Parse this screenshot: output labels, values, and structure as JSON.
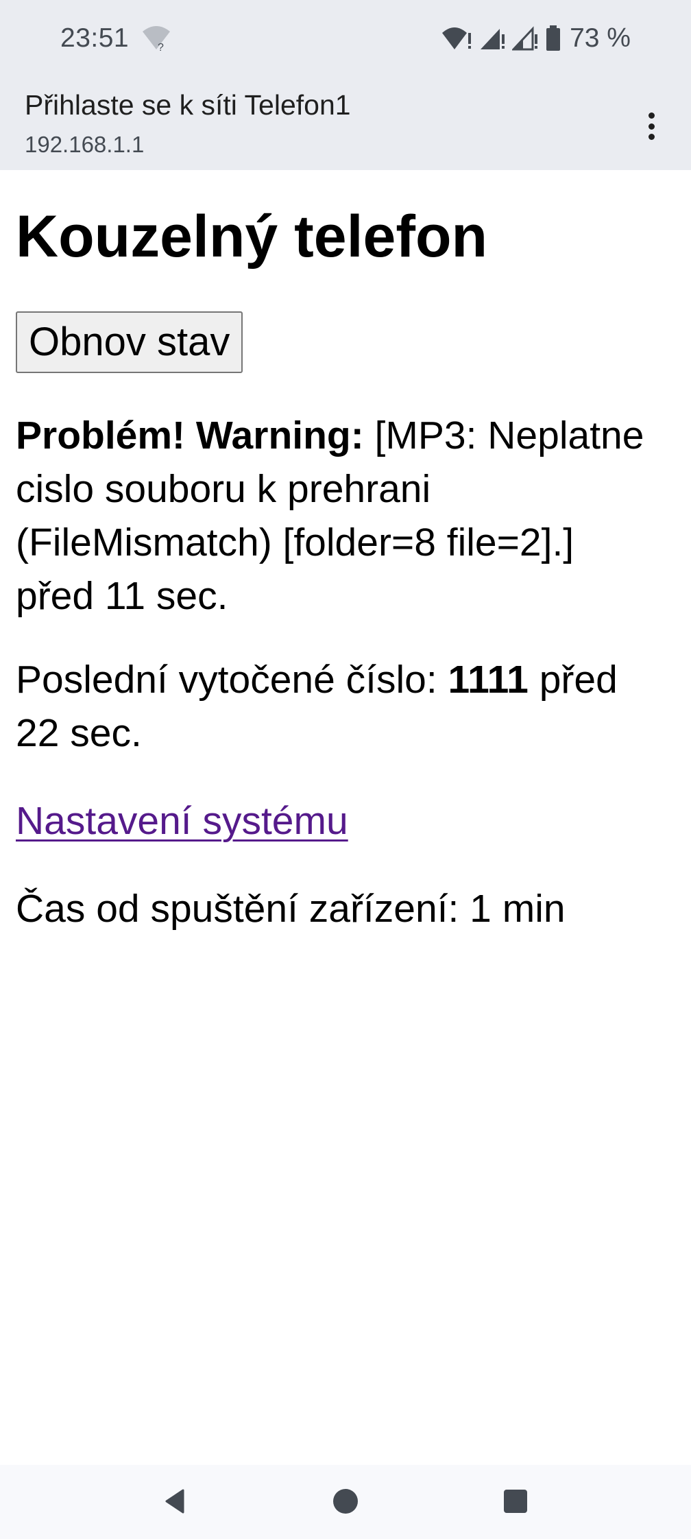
{
  "status_bar": {
    "time": "23:51",
    "battery_percent": "73 %",
    "icons": [
      "wifi-unknown-icon",
      "wifi-warning-icon",
      "signal-warning-icon",
      "signal-warning-icon",
      "battery-icon"
    ]
  },
  "browser": {
    "title": "Přihlaste se k síti Telefon1",
    "url": "192.168.1.1",
    "menu_icon": "more-vert-icon"
  },
  "page": {
    "heading": "Kouzelný telefon",
    "refresh_button": "Obnov stav",
    "problem": {
      "label": "Problém! Warning:",
      "message": " [MP3: Neplatne cislo souboru k prehrani (FileMismatch) [folder=8 file=2].] před 11 sec."
    },
    "last_dialed": {
      "label": "Poslední vytočené číslo: ",
      "number": "1111",
      "suffix": " před 22 sec."
    },
    "settings_link": "Nastavení systému",
    "uptime": "Čas od spuštění zařízení: 1 min"
  },
  "nav_bar": {
    "icons": [
      "back-icon",
      "home-icon",
      "recents-icon"
    ]
  },
  "colors": {
    "chrome_bg": "#eaecf1",
    "link_visited": "#551a8b",
    "nav_bg": "#f8f9fc"
  }
}
